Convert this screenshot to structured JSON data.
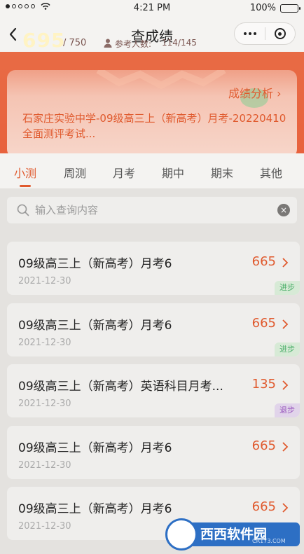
{
  "status_bar": {
    "time": "4:21 PM",
    "battery": "100%"
  },
  "nav": {
    "title": "查成绩"
  },
  "summary": {
    "score": "695",
    "total": "/ 750",
    "participants_label": "参考人数:",
    "participants_value": "114/145",
    "analysis_link": "成绩分析 ›",
    "exam_name": "石家庄实验中学-09级高三上（新高考）月考-20220410全面测评考试..."
  },
  "tabs": [
    {
      "label": "小测"
    },
    {
      "label": "周测"
    },
    {
      "label": "月考"
    },
    {
      "label": "期中"
    },
    {
      "label": "期末"
    },
    {
      "label": "其他"
    }
  ],
  "search": {
    "placeholder": "输入查询内容",
    "value": ""
  },
  "exams": [
    {
      "title": "09级高三上（新高考）月考6",
      "date": "2021-12-30",
      "score": "665",
      "trend": "进步"
    },
    {
      "title": "09级高三上（新高考）月考6",
      "date": "2021-12-30",
      "score": "665",
      "trend": "进步"
    },
    {
      "title": "09级高三上（新高考）英语科目月考...",
      "date": "2021-12-30",
      "score": "135",
      "trend": "退步"
    },
    {
      "title": "09级高三上（新高考）月考6",
      "date": "2021-12-30",
      "score": "665",
      "trend": ""
    },
    {
      "title": "09级高三上（新高考）月考6",
      "date": "2021-12-30",
      "score": "665",
      "trend": ""
    }
  ],
  "watermark": {
    "text": "西西软件园",
    "sub": "CR173.COM"
  },
  "colors": {
    "accent": "#e05a2e",
    "banner": "#e8623d",
    "up": "#4caf6a",
    "down": "#9b5cbf"
  }
}
